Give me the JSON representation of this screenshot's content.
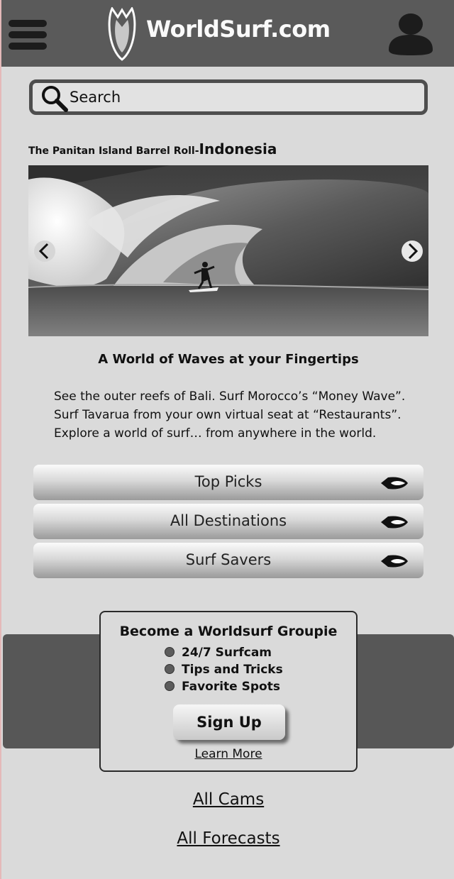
{
  "header": {
    "brand": "WorldSurf.com"
  },
  "search": {
    "placeholder": "Search"
  },
  "feature": {
    "title_prefix": "The Panitan Island Barrel Roll-",
    "title_location": "Indonesia"
  },
  "intro": {
    "tagline": "A World of Waves at your Fingertips",
    "lines": [
      "See the outer reefs of Bali. Surf Morocco’s “Money Wave”.",
      "Surf Tavarua from your own virtual seat at “Restaurants”.",
      "Explore a world of surf… from anywhere in the world."
    ]
  },
  "nav": {
    "items": [
      "Top Picks",
      "All Destinations",
      "Surf Savers"
    ]
  },
  "groupie": {
    "title": "Become a Worldsurf Groupie",
    "features": [
      "24/7 Surfcam",
      "Tips and Tricks",
      "Favorite Spots"
    ],
    "signup_label": "Sign Up",
    "learn_more": "Learn More"
  },
  "footer": {
    "links": [
      "All Cams",
      "All Forecasts"
    ]
  }
}
